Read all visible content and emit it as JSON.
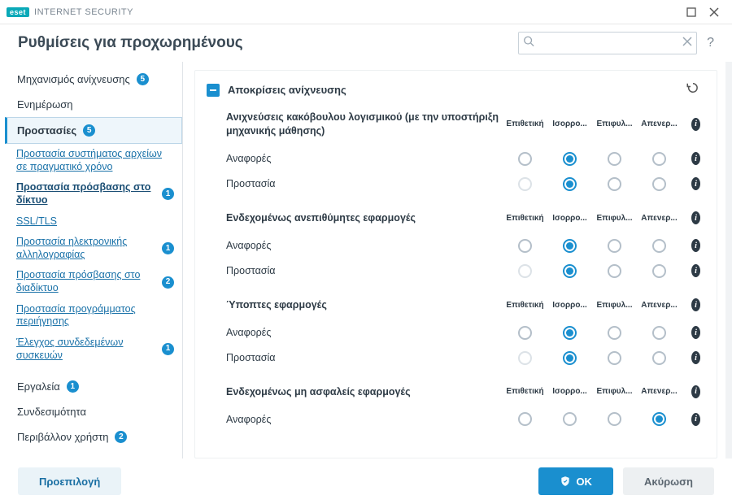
{
  "brand": {
    "badge": "eset",
    "name": "INTERNET SECURITY"
  },
  "header": {
    "title": "Ρυθμίσεις για προχωρημένους",
    "search_placeholder": ""
  },
  "sidebar": {
    "items": [
      {
        "label": "Μηχανισμός ανίχνευσης",
        "badge": "5"
      },
      {
        "label": "Ενημέρωση"
      },
      {
        "label": "Προστασίες",
        "badge": "5",
        "selected": true
      },
      {
        "label": "Εργαλεία",
        "badge": "1"
      },
      {
        "label": "Συνδεσιμότητα"
      },
      {
        "label": "Περιβάλλον χρήστη",
        "badge": "2"
      }
    ],
    "subs": [
      {
        "label": "Προστασία συστήματος αρχείων σε πραγματικό χρόνο"
      },
      {
        "label": "Προστασία πρόσβασης στο δίκτυο",
        "badge": "1",
        "active": true
      },
      {
        "label": "SSL/TLS"
      },
      {
        "label": "Προστασία ηλεκτρονικής αλληλογραφίας",
        "badge": "1"
      },
      {
        "label": "Προστασία πρόσβασης στο διαδίκτυο",
        "badge": "2"
      },
      {
        "label": "Προστασία προγράμματος περιήγησης"
      },
      {
        "label": "Έλεγχος συνδεδεμένων συσκευών",
        "badge": "1"
      }
    ]
  },
  "panel": {
    "title": "Αποκρίσεις ανίχνευσης",
    "columns": [
      "Επιθετική",
      "Ισορρο...",
      "Επιφυλ...",
      "Απενερ..."
    ],
    "groups": [
      {
        "title": "Ανιχνεύσεις κακόβουλου λογισμικού (με την υποστήριξη μηχανικής μάθησης)",
        "rows": [
          {
            "label": "Αναφορές",
            "selected": 1,
            "disabled": []
          },
          {
            "label": "Προστασία",
            "selected": 1,
            "disabled": [
              0
            ]
          }
        ]
      },
      {
        "title": "Ενδεχομένως ανεπιθύμητες εφαρμογές",
        "rows": [
          {
            "label": "Αναφορές",
            "selected": 1,
            "disabled": []
          },
          {
            "label": "Προστασία",
            "selected": 1,
            "disabled": [
              0
            ]
          }
        ]
      },
      {
        "title": "Ύποπτες εφαρμογές",
        "rows": [
          {
            "label": "Αναφορές",
            "selected": 1,
            "disabled": []
          },
          {
            "label": "Προστασία",
            "selected": 1,
            "disabled": [
              0
            ]
          }
        ]
      },
      {
        "title": "Ενδεχομένως μη ασφαλείς εφαρμογές",
        "rows": [
          {
            "label": "Αναφορές",
            "selected": 3,
            "disabled": []
          }
        ]
      }
    ]
  },
  "footer": {
    "default": "Προεπιλογή",
    "ok": "OK",
    "cancel": "Ακύρωση"
  }
}
